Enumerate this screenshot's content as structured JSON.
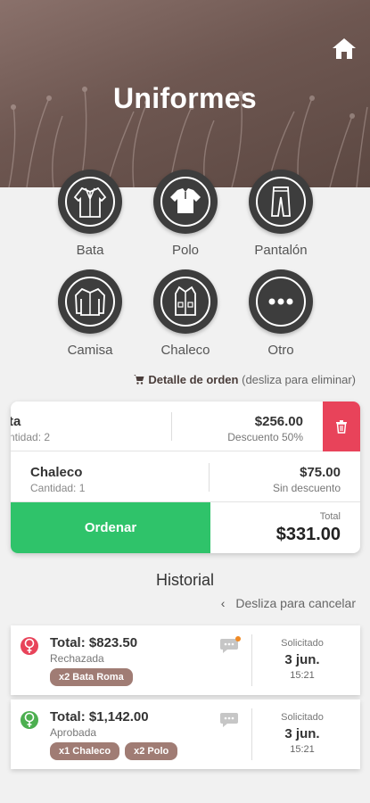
{
  "header": {
    "title": "Uniformes",
    "home_icon": "home-icon",
    "bg_color": "#6e5751"
  },
  "categories": [
    {
      "label": "Bata",
      "icon": "robe-icon"
    },
    {
      "label": "Polo",
      "icon": "polo-shirt-icon"
    },
    {
      "label": "Pantalón",
      "icon": "pants-icon"
    },
    {
      "label": "Camisa",
      "icon": "shirt-icon"
    },
    {
      "label": "Chaleco",
      "icon": "vest-icon"
    },
    {
      "label": "Otro",
      "icon": "more-icon"
    }
  ],
  "order": {
    "title": "Detalle de orden",
    "hint": "(desliza para eliminar)",
    "items": [
      {
        "name": "ta",
        "qty": "ntidad: 2",
        "price": "$256.00",
        "discount": "Descuento 50%"
      },
      {
        "name": "Chaleco",
        "qty": "Cantidad: 1",
        "price": "$75.00",
        "discount": "Sin descuento"
      }
    ],
    "order_button": "Ordenar",
    "total_label": "Total",
    "total_value": "$331.00",
    "accent_green": "#2fc36a",
    "delete_color": "#e8435a"
  },
  "history": {
    "title": "Historial",
    "hint": "Desliza para cancelar",
    "items": [
      {
        "total": "Total: $823.50",
        "state": "Rechazada",
        "status_color": "#e8435a",
        "tags": [
          "x2 Bata Roma"
        ],
        "has_unread": true,
        "requested_label": "Solicitado",
        "date": "3 jun.",
        "time": "15:21"
      },
      {
        "total": "Total: $1,142.00",
        "state": "Aprobada",
        "status_color": "#4caf50",
        "tags": [
          "x1 Chaleco",
          "x2 Polo"
        ],
        "has_unread": false,
        "requested_label": "Solicitado",
        "date": "3 jun.",
        "time": "15:21"
      }
    ]
  }
}
